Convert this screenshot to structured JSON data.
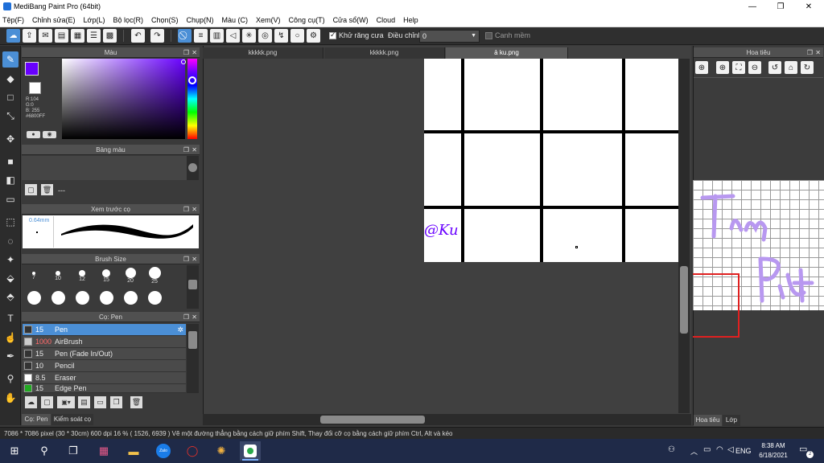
{
  "window": {
    "title": "MediBang Paint Pro (64bit)",
    "minimize_icon": "—",
    "restore_icon": "❐",
    "close_icon": "✕"
  },
  "menu": [
    "Tệp(F)",
    "Chỉnh sửa(E)",
    "Lớp(L)",
    "Bộ lọc(R)",
    "Chọn(S)",
    "Chụp(N)",
    "Màu (C)",
    "Xem(V)",
    "Công cụ(T)",
    "Cửa sổ(W)",
    "Cloud",
    "Help"
  ],
  "toolbar": {
    "antialias_label": "Khử răng cưa",
    "antialias_checked": true,
    "adjust_label": "Điều chỉnh",
    "adjust_value": "0",
    "smooth_label": "Canh mềm"
  },
  "panels": {
    "color": {
      "title": "Màu",
      "rgb_r": "R:104",
      "rgb_g": "G:0",
      "rgb_b": "B: 255",
      "hex": "#6800FF",
      "current_color": "#6800ff"
    },
    "palette": {
      "title": "Bảng màu",
      "footer_text": "---"
    },
    "brush_preview": {
      "title": "Xem trước cọ",
      "size_label": "0.64mm"
    },
    "brush_size": {
      "title": "Brush Size",
      "sizes": [
        "7",
        "10",
        "12",
        "15",
        "20",
        "25"
      ]
    },
    "brush": {
      "title": "Cọ: Pen",
      "items": [
        {
          "size": "15",
          "name": "Pen",
          "color": "#333333"
        },
        {
          "size": "1000",
          "name": "AirBrush",
          "color": "#cccccc"
        },
        {
          "size": "15",
          "name": "Pen (Fade In/Out)",
          "color": "#333333"
        },
        {
          "size": "10",
          "name": "Pencil",
          "color": "#333333"
        },
        {
          "size": "8.5",
          "name": "Eraser",
          "color": "#ffffff"
        },
        {
          "size": "15",
          "name": "Edge Pen",
          "color": "#22aa22"
        }
      ]
    },
    "bottom_tabs": [
      "Cọ: Pen",
      "Kiểm soát cọ"
    ],
    "navigator": {
      "title": "Hoa tiêu",
      "tabs": [
        "Hoa tiêu",
        "Lớp"
      ]
    }
  },
  "documents": {
    "tabs": [
      "kkkkk.png",
      "kkkkk.png",
      "ả ku.png"
    ],
    "active": 2,
    "signature": "@Ku"
  },
  "status_bar": {
    "dimensions": "7086 * 7086 pixel",
    "size_cm": "(30 * 30cm)",
    "dpi": "600 dpi",
    "zoom": "16 %",
    "coords": "( 1526, 6939 )",
    "hint": "Vẽ một đường thẳng bằng cách giữ phím Shift, Thay đổi cỡ cọ bằng cách giữ phím Ctrl, Alt và kéo"
  },
  "taskbar": {
    "tray_lang": "ENG",
    "time": "8:38 AM",
    "date": "6/18/2021",
    "notification_count": "2",
    "zalo_label": "Zalo"
  }
}
